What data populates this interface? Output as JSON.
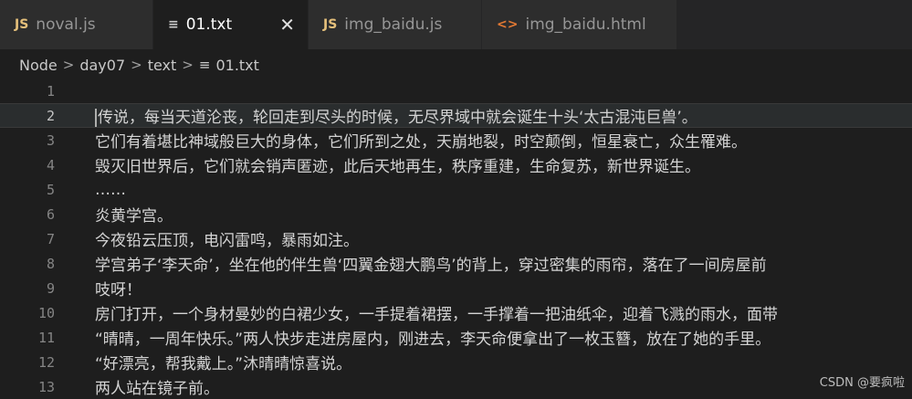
{
  "tabs": [
    {
      "label": "noval.js",
      "icon": "js-file-icon",
      "icon_text": "JS",
      "active": false
    },
    {
      "label": "01.txt",
      "icon": "text-file-icon",
      "icon_text": "≡",
      "active": true,
      "close": "✕"
    },
    {
      "label": "img_baidu.js",
      "icon": "js-file-icon",
      "icon_text": "JS",
      "active": false
    },
    {
      "label": "img_baidu.html",
      "icon": "html-file-icon",
      "icon_text": "<>",
      "active": false
    }
  ],
  "breadcrumb": {
    "items": [
      "Node",
      "day07",
      "text"
    ],
    "file_icon": "≡",
    "file": "01.txt",
    "separator": ">"
  },
  "editor": {
    "current_line": 2,
    "lines": [
      {
        "num": "1",
        "text": ""
      },
      {
        "num": "2",
        "text": "传说，每当天道沦丧，轮回走到尽头的时候，无尽界域中就会诞生十头‘太古混沌巨兽’。"
      },
      {
        "num": "3",
        "text": "它们有着堪比神域般巨大的身体，它们所到之处，天崩地裂，时空颠倒，恒星衰亡，众生罹难。"
      },
      {
        "num": "4",
        "text": "毁灭旧世界后，它们就会销声匿迹，此后天地再生，秩序重建，生命复苏，新世界诞生。"
      },
      {
        "num": "5",
        "text": "……"
      },
      {
        "num": "6",
        "text": "炎黄学宫。"
      },
      {
        "num": "7",
        "text": "今夜铅云压顶，电闪雷鸣，暴雨如注。"
      },
      {
        "num": "8",
        "text": "学宫弟子‘李天命’，坐在他的伴生兽‘四翼金翅大鹏鸟’的背上，穿过密集的雨帘，落在了一间房屋前"
      },
      {
        "num": "9",
        "text": "吱呀！"
      },
      {
        "num": "10",
        "text": "房门打开，一个身材曼妙的白裙少女，一手提着裙摆，一手撑着一把油纸伞，迎着飞溅的雨水，面带"
      },
      {
        "num": "11",
        "text": "“晴晴，一周年快乐。”两人快步走进房屋内，刚进去，李天命便拿出了一枚玉簪，放在了她的手里。"
      },
      {
        "num": "12",
        "text": "“好漂亮，帮我戴上。”沐晴晴惊喜说。"
      },
      {
        "num": "13",
        "text": "两人站在镜子前。"
      }
    ]
  },
  "watermark": "CSDN @要疯啦"
}
